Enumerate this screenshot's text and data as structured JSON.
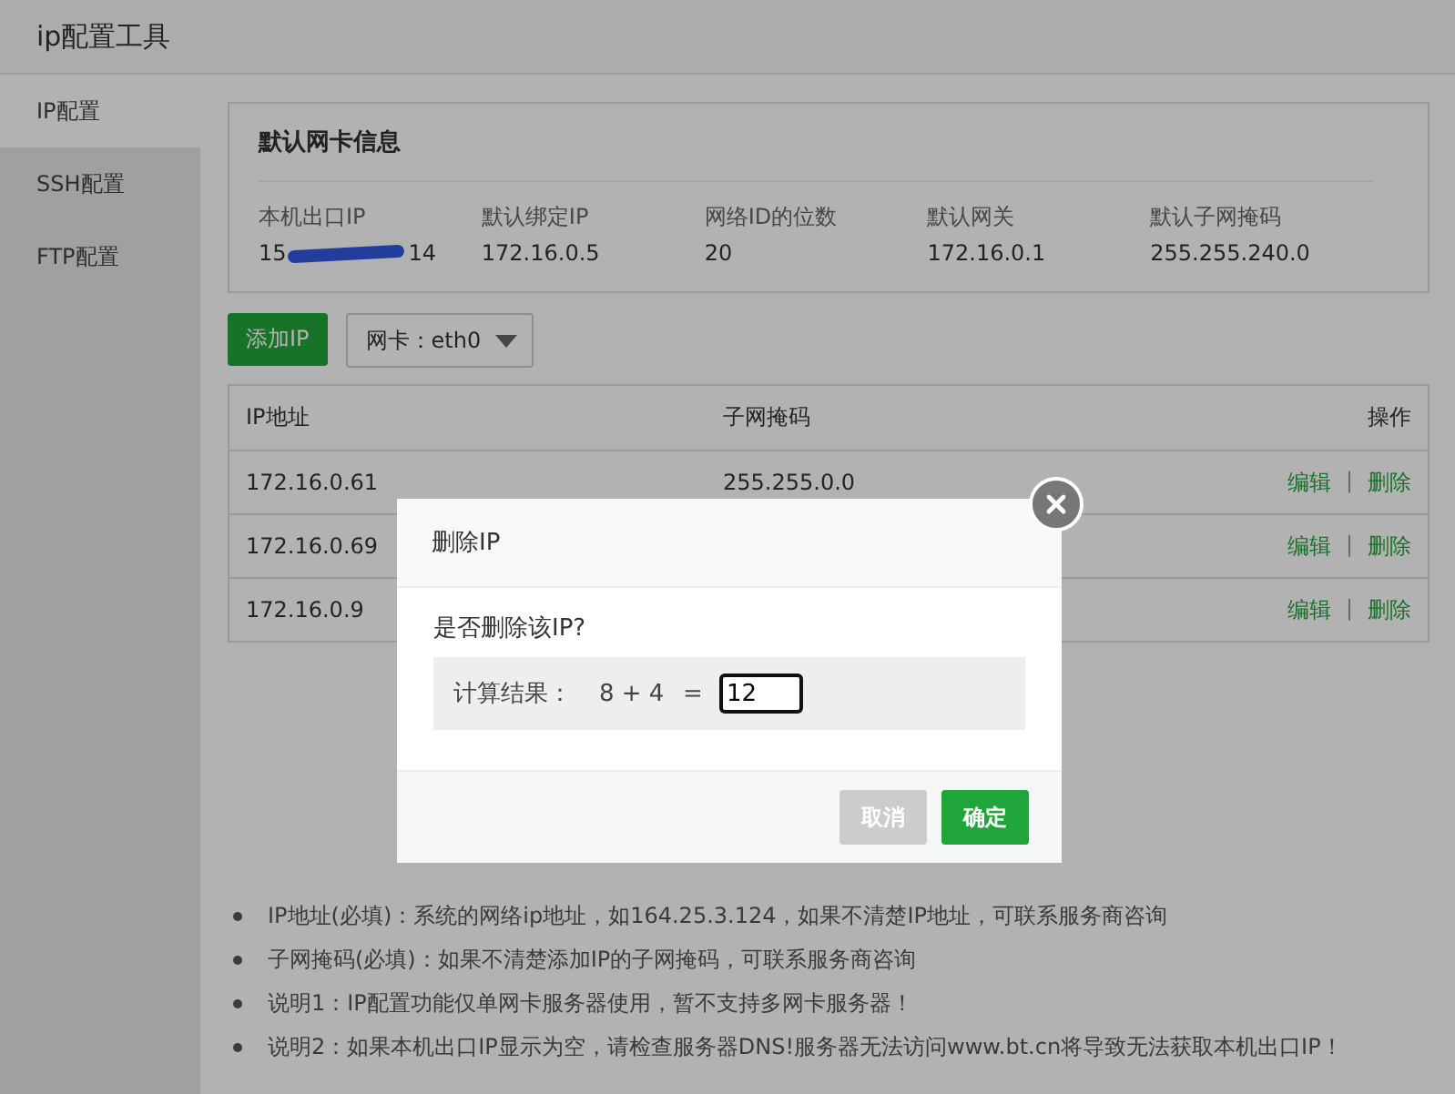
{
  "window": {
    "title": "ip配置工具"
  },
  "sidebar": {
    "items": [
      {
        "label": "IP配置",
        "selected": true
      },
      {
        "label": "SSH配置",
        "selected": false
      },
      {
        "label": "FTP配置",
        "selected": false
      }
    ]
  },
  "info_card": {
    "title": "默认网卡信息",
    "fields": [
      {
        "label": "本机出口IP",
        "value_start": "15",
        "redacted": true,
        "value_end": "14"
      },
      {
        "label": "默认绑定IP",
        "value_start": "172.16.0.5"
      },
      {
        "label": "网络ID的位数",
        "value_start": "20"
      },
      {
        "label": "默认网关",
        "value_start": "172.16.0.1"
      },
      {
        "label": "默认子网掩码",
        "value_start": "255.255.240.0"
      }
    ]
  },
  "toolbar": {
    "add_button": "添加IP",
    "nic_select": "网卡：eth0"
  },
  "table": {
    "columns": [
      "IP地址",
      "子网掩码",
      "操作"
    ],
    "rows": [
      {
        "ip": "172.16.0.61",
        "mask": "255.255.0.0",
        "edit": "编辑",
        "separator": "|",
        "delete": "删除"
      },
      {
        "ip": "172.16.0.69",
        "edit": "编辑",
        "separator": "|",
        "delete": "删除"
      },
      {
        "ip": "172.16.0.9",
        "edit": "编辑",
        "separator": "|",
        "delete": "删除"
      }
    ]
  },
  "notes": [
    "IP地址(必填)：系统的网络ip地址，如164.25.3.124，如果不清楚IP地址，可联系服务商咨询",
    "子网掩码(必填)：如果不清楚添加IP的子网掩码，可联系服务商咨询",
    "说明1：IP配置功能仅单网卡服务器使用，暂不支持多网卡服务器！",
    "说明2：如果本机出口IP显示为空，请检查服务器DNS!服务器无法访问www.bt.cn将导致无法获取本机出口IP！"
  ],
  "dialog": {
    "title": "删除IP",
    "question": "是否删除该IP?",
    "captcha_label": "计算结果：",
    "expression": "8 + 4",
    "equals": "=",
    "answer": "12",
    "buttons": [
      {
        "label": "取消",
        "kind": "cancel"
      },
      {
        "label": "确定",
        "kind": "confirm"
      }
    ]
  }
}
